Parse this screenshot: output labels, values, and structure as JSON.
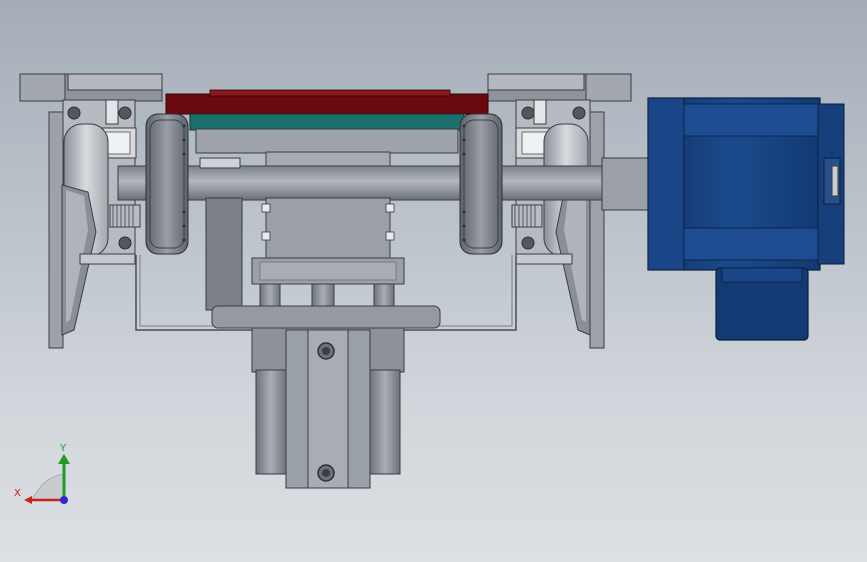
{
  "triad": {
    "x_label": "X",
    "y_label": "Y",
    "x_color": "#c8201c",
    "y_color": "#1f9a25",
    "z_color": "#2a2ad0"
  },
  "colors": {
    "background_top": "#a4adb7",
    "background_bottom": "#dcdfe3",
    "motor_blue": "#17427d",
    "plate_red": "#6a0a0f",
    "plate_teal": "#1c6f6c",
    "steel_gray": "#8e939c",
    "bracket_light": "#c9ccd1"
  }
}
